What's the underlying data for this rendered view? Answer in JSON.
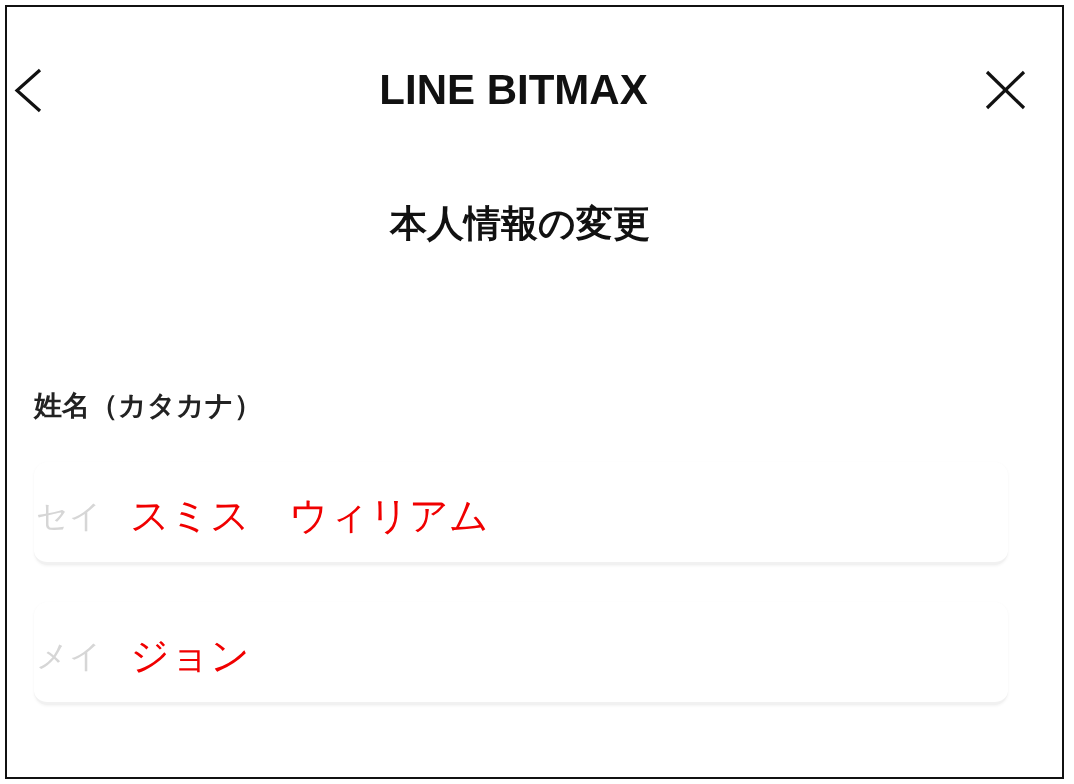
{
  "header": {
    "title": "LINE BITMAX"
  },
  "page_title": "本人情報の変更",
  "form": {
    "label": "姓名（カタカナ）",
    "fields": [
      {
        "label": "セイ",
        "value": "スミス　ウィリアム"
      },
      {
        "label": "メイ",
        "value": "ジョン"
      }
    ]
  }
}
